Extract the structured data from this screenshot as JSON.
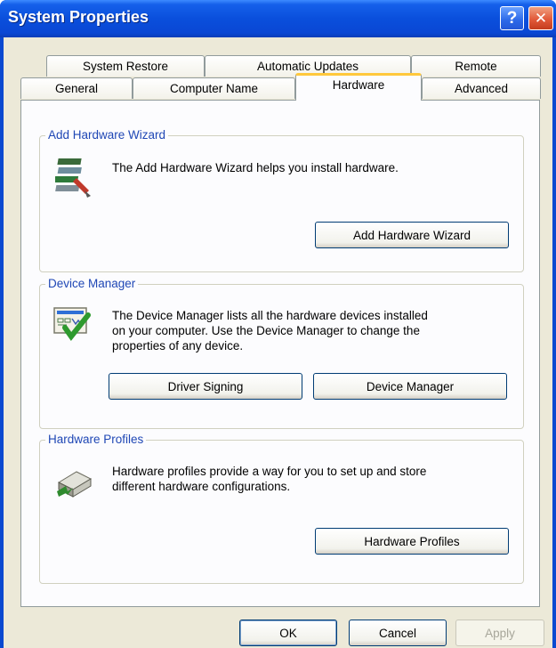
{
  "window": {
    "title": "System Properties",
    "help_glyph": "?",
    "close_glyph": "✕"
  },
  "tabs": {
    "row1": [
      "System Restore",
      "Automatic Updates",
      "Remote"
    ],
    "row2": [
      "General",
      "Computer Name",
      "Hardware",
      "Advanced"
    ],
    "active": "Hardware"
  },
  "groups": {
    "add_hardware": {
      "label": "Add Hardware Wizard",
      "description": "The Add Hardware Wizard helps you install hardware.",
      "button": "Add Hardware Wizard",
      "icon": "add-hardware-wizard-icon"
    },
    "device_manager": {
      "label": "Device Manager",
      "description_lines": [
        "The Device Manager lists all the hardware devices installed",
        "on your computer. Use the Device Manager to change the",
        "properties of any device."
      ],
      "driver_signing_button": "Driver Signing",
      "device_manager_button": "Device Manager",
      "icon": "device-manager-icon"
    },
    "hardware_profiles": {
      "label": "Hardware Profiles",
      "description_lines": [
        "Hardware profiles provide a way for you to set up and store",
        "different hardware configurations."
      ],
      "button": "Hardware Profiles",
      "icon": "hardware-profiles-icon"
    }
  },
  "footer": {
    "ok": "OK",
    "cancel": "Cancel",
    "apply": "Apply"
  },
  "colors": {
    "titlebar": "#0a4fdc",
    "group_label": "#1f47b5",
    "active_tab_accent": "#ffc83c",
    "dialog_face": "#ece9d8"
  }
}
